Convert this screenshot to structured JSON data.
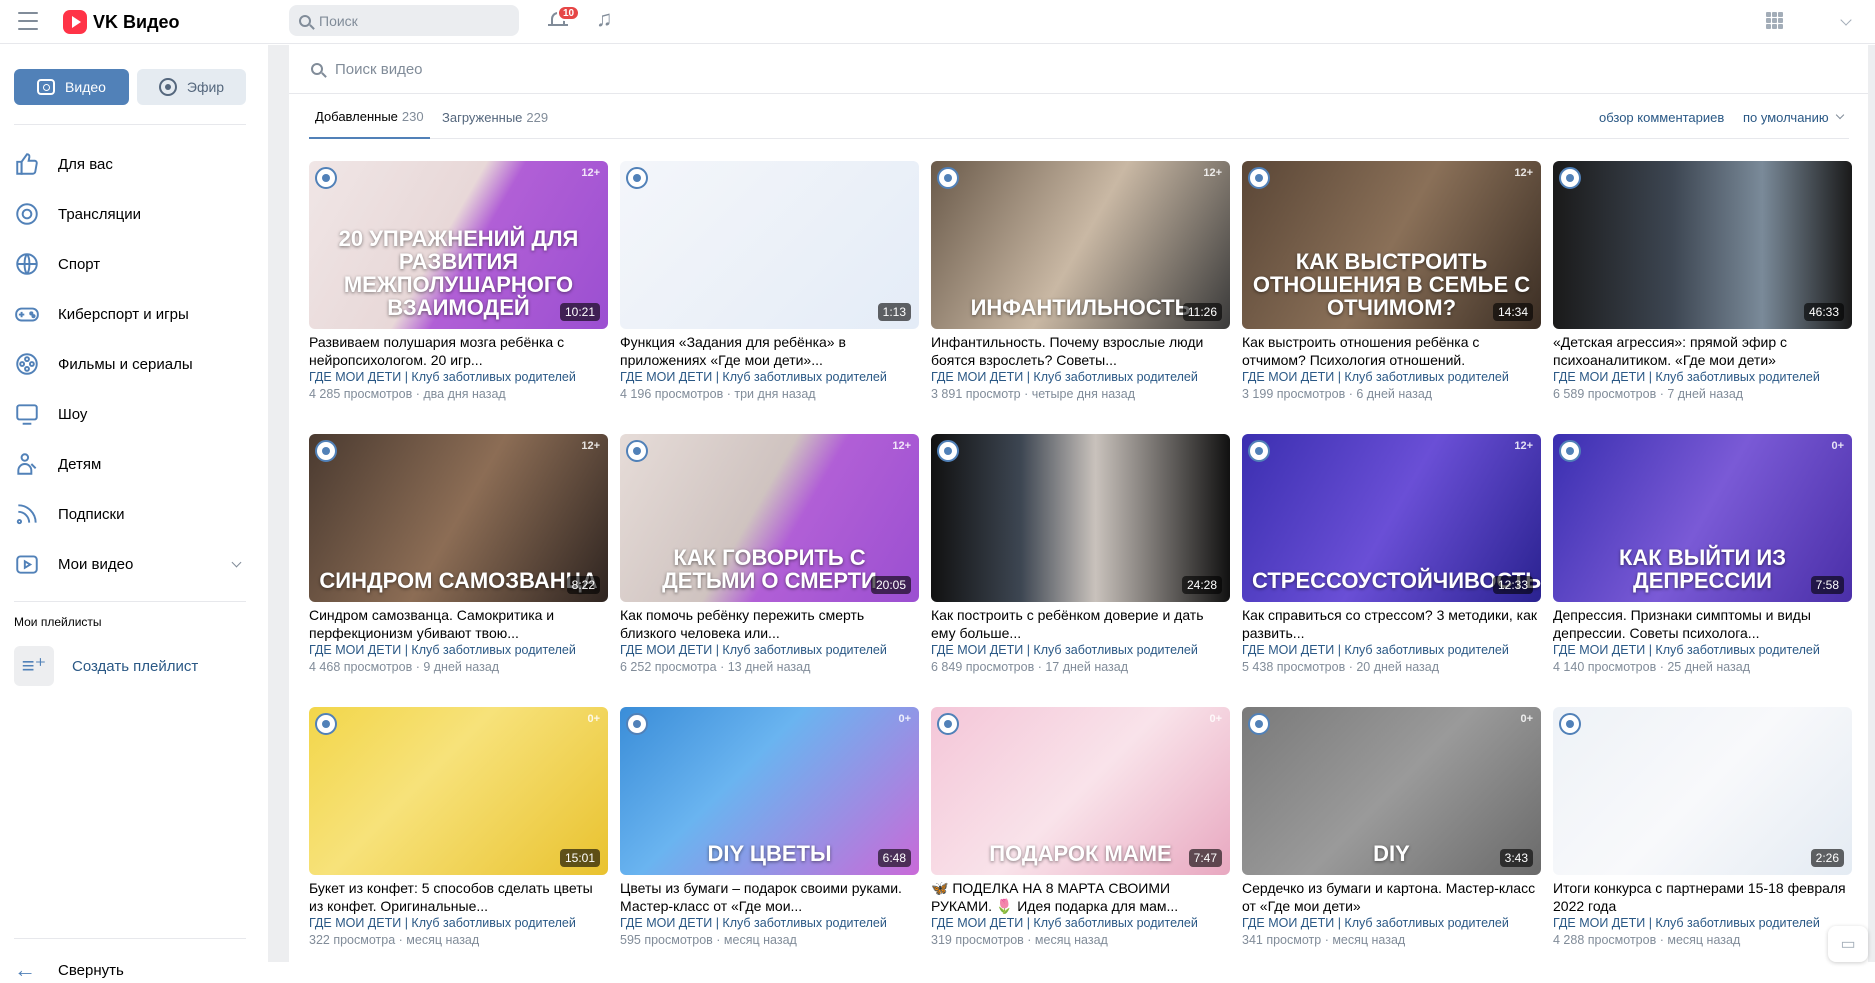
{
  "header": {
    "app_name": "VK Видео",
    "search_placeholder": "Поиск",
    "notifications_count": "10",
    "music_icon": "music-note-icon",
    "apps_icon": "apps-grid-icon"
  },
  "sidebar": {
    "btn_video": "Видео",
    "btn_efir": "Эфир",
    "items": [
      {
        "label": "Для вас",
        "icon": "thumbs-up-icon"
      },
      {
        "label": "Трансляции",
        "icon": "broadcast-icon"
      },
      {
        "label": "Спорт",
        "icon": "ball-icon"
      },
      {
        "label": "Киберспорт и игры",
        "icon": "gamepad-icon"
      },
      {
        "label": "Фильмы и сериалы",
        "icon": "film-reel-icon"
      },
      {
        "label": "Шоу",
        "icon": "monitor-icon"
      },
      {
        "label": "Детям",
        "icon": "kids-icon"
      },
      {
        "label": "Подписки",
        "icon": "subscriptions-icon"
      },
      {
        "label": "Мои видео",
        "icon": "my-video-icon"
      }
    ],
    "playlists_heading": "Мои плейлисты",
    "create_playlist": "Создать плейлист",
    "collapse": "Свернуть"
  },
  "main": {
    "search_placeholder": "Поиск видео",
    "tabs": [
      {
        "label": "Добавленные",
        "count": "230"
      },
      {
        "label": "Загруженные",
        "count": "229"
      }
    ],
    "review_comments": "обзор комментариев",
    "sort": "по умолчанию",
    "channel": "ГДЕ МОИ ДЕТИ | Клуб заботливых родителей",
    "videos": [
      {
        "title": "Развиваем полушария мозга ребёнка с нейропсихологом. 20 игр...",
        "views": "4 285 просмотров",
        "ago": "два дня назад",
        "duration": "10:21",
        "age": "12+",
        "overlay": "20 УПРАЖНЕНИЙ ДЛЯ РАЗВИТИЯ МЕЖПОЛУШАРНОГО ВЗАИМОДЕЙ",
        "bg": "linear-gradient(120deg,#f0e6e6 0%,#e8d8d8 45%,#b15fd6 55%,#9b4fd1 100%)"
      },
      {
        "title": "Функция «Задания для ребёнка» в приложениях «Где мои дети»...",
        "views": "4 196 просмотров",
        "ago": "три дня назад",
        "duration": "1:13",
        "age": "",
        "overlay": "",
        "bg": "linear-gradient(135deg,#f4f6fa 0%,#e4ecf7 100%)"
      },
      {
        "title": "Инфантильность. Почему взрослые люди боятся взрослеть? Советы...",
        "views": "3 891 просмотр",
        "ago": "четыре дня назад",
        "duration": "11:26",
        "age": "12+",
        "overlay": "ИНФАНТИЛЬНОСТЬ",
        "bg": "linear-gradient(120deg,#6a5a4a 0%,#c9b8a4 50%,#3a3a3a 100%)"
      },
      {
        "title": "Как выстроить отношения ребёнка с отчимом? Психология отношений.",
        "views": "3 199 просмотров",
        "ago": "6 дней назад",
        "duration": "14:34",
        "age": "12+",
        "overlay": "КАК ВЫСТРОИТЬ ОТНОШЕНИЯ В СЕМЬЕ С ОТЧИМОМ?",
        "bg": "linear-gradient(120deg,#5a4636 0%,#8a7058 50%,#3b2e24 100%)"
      },
      {
        "title": "«Детская агрессия»: прямой эфир с психоаналитиком. «Где мои дети»",
        "views": "6 589 просмотров",
        "ago": "7 дней назад",
        "duration": "46:33",
        "age": "",
        "overlay": "",
        "bg": "linear-gradient(90deg,#1a1a1a 0%,#3d4652 40%,#7a8a99 70%,#1a1a1a 100%)"
      },
      {
        "title": "Синдром самозванца. Самокритика и перфекционизм убивают твою...",
        "views": "4 468 просмотров",
        "ago": "9 дней назад",
        "duration": "8:22",
        "age": "12+",
        "overlay": "СИНДРОМ САМОЗВАНЦА",
        "bg": "linear-gradient(120deg,#4a3a30 0%,#8c6d55 50%,#2e2420 100%)"
      },
      {
        "title": "Как помочь ребёнку пережить смерть близкого человека или...",
        "views": "6 252 просмотра",
        "ago": "13 дней назад",
        "duration": "20:05",
        "age": "12+",
        "overlay": "КАК ГОВОРИТЬ С ДЕТЬМИ О СМЕРТИ",
        "bg": "linear-gradient(120deg,#e6dcd8 0%,#cfc3c0 45%,#b15fd6 58%,#9b4fd1 100%)"
      },
      {
        "title": "Как построить с ребёнком доверие и дать ему больше...",
        "views": "6 849 просмотров",
        "ago": "17 дней назад",
        "duration": "24:28",
        "age": "",
        "overlay": "",
        "bg": "linear-gradient(90deg,#111 0%,#3d4652 30%,#c9c2bc 55%,#111 100%)"
      },
      {
        "title": "Как справиться со стрессом? 3 методики, как развить...",
        "views": "5 438 просмотров",
        "ago": "20 дней назад",
        "duration": "12:33",
        "age": "12+",
        "overlay": "СТРЕССОУСТОЙЧИВОСТЬ",
        "bg": "linear-gradient(120deg,#3b2fb0 0%,#6a4fd6 50%,#2a2290 100%)"
      },
      {
        "title": "Депрессия. Признаки симптомы и виды депрессии. Советы психолога...",
        "views": "4 140 просмотров",
        "ago": "25 дней назад",
        "duration": "7:58",
        "age": "0+",
        "overlay": "КАК ВЫЙТИ ИЗ ДЕПРЕССИИ",
        "bg": "linear-gradient(120deg,#3a2fb0 0%,#7a5ad6 50%,#4a2fa8 100%)"
      },
      {
        "title": "Букет из конфет: 5 способов сделать цветы из конфет. Оригинальные...",
        "views": "322 просмотра",
        "ago": "месяц назад",
        "duration": "15:01",
        "age": "0+",
        "overlay": "",
        "bg": "linear-gradient(135deg,#f2d64a 0%,#f7e27a 40%,#e9c22f 100%)"
      },
      {
        "title": "Цветы из бумаги – подарок своими руками. Мастер-класс от «Где мои...",
        "views": "595 просмотров",
        "ago": "месяц назад",
        "duration": "6:48",
        "age": "0+",
        "overlay": "DIY ЦВЕТЫ",
        "bg": "linear-gradient(135deg,#3a8dd8 0%,#6ab4f0 40%,#c96ad8 100%)"
      },
      {
        "title": "🦋 ПОДЕЛКА НА 8 МАРТА СВОИМИ РУКАМИ. 🌷 Идея подарка для мам...",
        "views": "319 просмотров",
        "ago": "месяц назад",
        "duration": "7:47",
        "age": "0+",
        "overlay": "ПОДАРОК МАМЕ",
        "bg": "linear-gradient(135deg,#f4c6d8 0%,#f9e3ea 50%,#e8a8c0 100%)"
      },
      {
        "title": "Сердечко из бумаги и картона. Мастер-класс от «Где мои дети»",
        "views": "341 просмотр",
        "ago": "месяц назад",
        "duration": "3:43",
        "age": "0+",
        "overlay": "DIY",
        "bg": "linear-gradient(135deg,#7a7a7a 0%,#9a9a9a 50%,#6a6a6a 100%)"
      },
      {
        "title": "Итоги конкурса с партнерами 15-18 февраля 2022 года",
        "views": "4 288 просмотров",
        "ago": "месяц назад",
        "duration": "2:26",
        "age": "",
        "overlay": "",
        "bg": "linear-gradient(135deg,#eef2f7 0%,#f8f9fb 50%,#e4ebf3 100%)"
      }
    ]
  }
}
